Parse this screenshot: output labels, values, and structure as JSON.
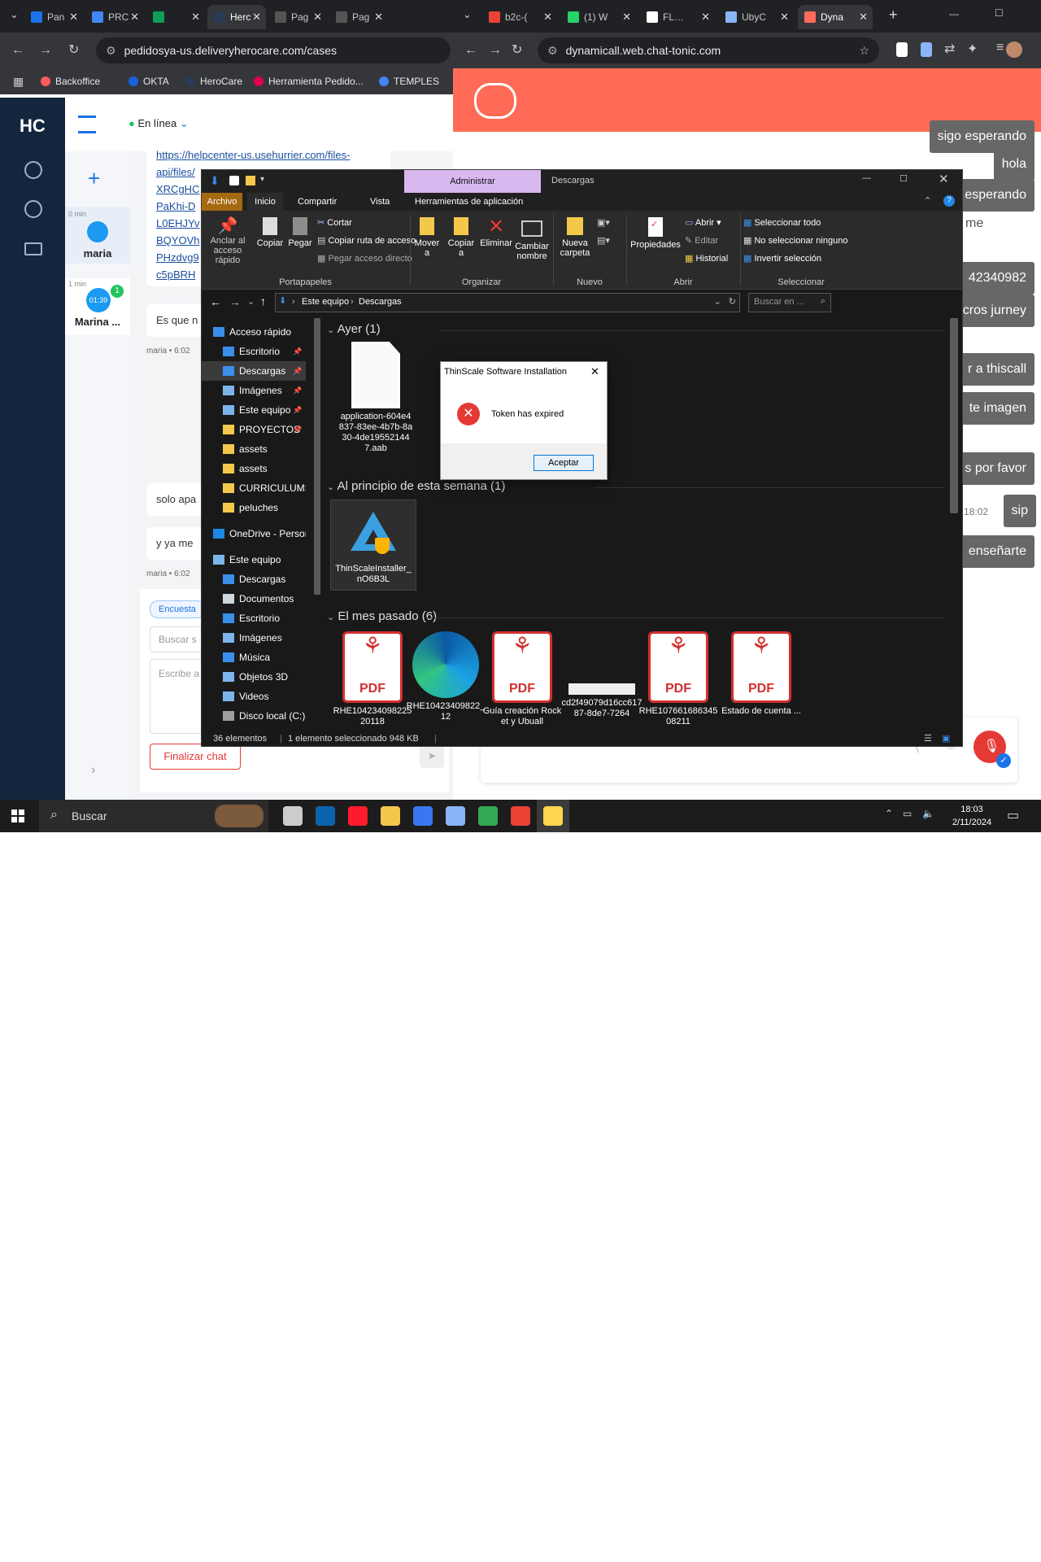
{
  "left_browser": {
    "tabs": [
      {
        "title": "Pan",
        "color": "#1a73e8"
      },
      {
        "title": "PRC",
        "color": "#4285f4"
      },
      {
        "title": "",
        "color": "#0f9d58"
      },
      {
        "title": "Herc",
        "color": "#2b3a55"
      },
      {
        "title": "Pag",
        "color": "#555555"
      },
      {
        "title": "Pag",
        "color": "#555555"
      }
    ],
    "url": "pedidosya-us.deliveryherocare.com/cases",
    "bookmarks": [
      {
        "label": "Backoffice",
        "color": "#ff5a5f"
      },
      {
        "label": "OKTA",
        "color": "#1662dd"
      },
      {
        "label": "HeroCare",
        "color": "#2b3a55"
      },
      {
        "label": "Herramienta Pedido...",
        "color": "#e0004d"
      },
      {
        "label": "TEMPLES",
        "color": "#4285f4"
      }
    ]
  },
  "herocare": {
    "logo": "HC",
    "status": "En línea",
    "contacts": [
      {
        "time": "0 min",
        "name": "maria",
        "timer": "",
        "badge": ""
      },
      {
        "time": "1 min",
        "name": "Marina ...",
        "timer": "01:39",
        "badge": "1"
      }
    ],
    "link_lines": [
      "https://helpcenter-us.usehurrier.com/files-",
      "api/files/",
      "XRCgHC",
      "PaKhi-D",
      "L0EHJYv",
      "BQYOVh",
      "PHzdvg9",
      "c5pBRH"
    ],
    "messages": [
      {
        "text": "Es que n",
        "meta": "maria • 6:02"
      },
      {
        "text": "solo apa",
        "meta": ""
      },
      {
        "text": "y ya me",
        "meta": "maria • 6:02"
      }
    ],
    "tag": "Encuesta",
    "search_placeholder": "Buscar s",
    "write_placeholder": "Escribe a",
    "end_chat": "Finalizar chat"
  },
  "right_browser": {
    "tabs": [
      {
        "title": "b2c-(",
        "color": "#ea4335"
      },
      {
        "title": "(1) W",
        "color": "#25d366"
      },
      {
        "title": "FLOR",
        "color": "#ffffff"
      },
      {
        "title": "UbyC",
        "color": "#8ab4f8"
      },
      {
        "title": "Dyna",
        "color": "#ff6b5a"
      }
    ],
    "url": "dynamicall.web.chat-tonic.com",
    "header_color": "#ff6b57",
    "messages": [
      {
        "text": "sigo esperando"
      },
      {
        "text": "hola"
      },
      {
        "text": "esperando"
      },
      {
        "text": "me"
      },
      {
        "text": "42340982"
      },
      {
        "text": "cros jurney"
      },
      {
        "text": "r a thiscall"
      },
      {
        "text": "te imagen"
      },
      {
        "text": "s por favor"
      },
      {
        "text": "sip",
        "time": "18:02"
      },
      {
        "text": "enseñarte"
      }
    ]
  },
  "explorer": {
    "title_tab_manage": "Administrar",
    "title": "Descargas",
    "ribbon_tabs": [
      "Archivo",
      "Inicio",
      "Compartir",
      "Vista",
      "Herramientas de aplicación"
    ],
    "clipboard": {
      "pin": "Anclar al acceso rápido",
      "copy": "Copiar",
      "paste": "Pegar",
      "cut": "Cortar",
      "copy_path": "Copiar ruta de acceso",
      "paste_shortcut": "Pegar acceso directo",
      "group": "Portapapeles"
    },
    "organize": {
      "move": "Mover a",
      "copy": "Copiar a",
      "delete": "Eliminar",
      "rename": "Cambiar nombre",
      "group": "Organizar"
    },
    "new": {
      "folder": "Nueva carpeta",
      "group": "Nuevo"
    },
    "open": {
      "properties": "Propiedades",
      "open": "Abrir",
      "edit": "Editar",
      "history": "Historial",
      "group": "Abrir"
    },
    "select": {
      "all": "Seleccionar todo",
      "none": "No seleccionar ninguno",
      "invert": "Invertir selección",
      "group": "Seleccionar"
    },
    "breadcrumb": [
      "Este equipo",
      "Descargas"
    ],
    "search_placeholder": "Buscar en ...",
    "nav": [
      {
        "label": "Acceso rápido",
        "indent": 0,
        "pin": false,
        "color": "#3b8eea"
      },
      {
        "label": "Escritorio",
        "indent": 1,
        "pin": true,
        "color": "#3b8eea"
      },
      {
        "label": "Descargas",
        "indent": 1,
        "pin": true,
        "color": "#3b8eea"
      },
      {
        "label": "Imágenes",
        "indent": 1,
        "pin": true,
        "color": "#7cb5ec"
      },
      {
        "label": "Este equipo",
        "indent": 1,
        "pin": true,
        "color": "#7cb5ec"
      },
      {
        "label": "PROYECTOS",
        "indent": 1,
        "pin": true,
        "color": "#f3c84b"
      },
      {
        "label": "assets",
        "indent": 1,
        "pin": false,
        "color": "#f3c84b"
      },
      {
        "label": "assets",
        "indent": 1,
        "pin": false,
        "color": "#f3c84b"
      },
      {
        "label": "CURRICULUMS",
        "indent": 1,
        "pin": false,
        "color": "#f3c84b"
      },
      {
        "label": "peluches",
        "indent": 1,
        "pin": false,
        "color": "#f3c84b"
      },
      {
        "label": "OneDrive - Person",
        "indent": 0,
        "pin": false,
        "color": "#1e88e5"
      },
      {
        "label": "Este equipo",
        "indent": 0,
        "pin": false,
        "color": "#7cb5ec"
      },
      {
        "label": "Descargas",
        "indent": 1,
        "pin": false,
        "color": "#3b8eea"
      },
      {
        "label": "Documentos",
        "indent": 1,
        "pin": false,
        "color": "#cfd8dc"
      },
      {
        "label": "Escritorio",
        "indent": 1,
        "pin": false,
        "color": "#3b8eea"
      },
      {
        "label": "Imágenes",
        "indent": 1,
        "pin": false,
        "color": "#7cb5ec"
      },
      {
        "label": "Música",
        "indent": 1,
        "pin": false,
        "color": "#3b8eea"
      },
      {
        "label": "Objetos 3D",
        "indent": 1,
        "pin": false,
        "color": "#7cb5ec"
      },
      {
        "label": "Videos",
        "indent": 1,
        "pin": false,
        "color": "#7cb5ec"
      },
      {
        "label": "Disco local (C:)",
        "indent": 1,
        "pin": false,
        "color": "#9e9e9e"
      }
    ],
    "sections": {
      "yesterday": "Ayer (1)",
      "this_week": "Al principio de esta semana (1)",
      "last_month": "El mes pasado (6)"
    },
    "files_yesterday": [
      {
        "name": "application-604e4837-83ee-4b7b-8a30-4de195521447.aab"
      }
    ],
    "files_week": [
      {
        "name": "ThinScaleInstaller_nO6B3L"
      }
    ],
    "files_month": [
      {
        "name": "RHE10423409822520118",
        "kind": "pdf"
      },
      {
        "name": "RHE10423409822_12",
        "kind": "edge"
      },
      {
        "name": "Guía creación Rocket y Ubuall",
        "kind": "pdf"
      },
      {
        "name": "cd2f49079d16cc61787-8de7-7264",
        "kind": "img"
      },
      {
        "name": "RHE10766168634508211",
        "kind": "pdf"
      },
      {
        "name": "Estado de cuenta ...",
        "kind": "pdf"
      }
    ],
    "status": {
      "count": "36 elementos",
      "selected": "1 elemento seleccionado 948 KB"
    }
  },
  "dialog": {
    "title": "ThinScale Software Installation",
    "message": "Token has expired",
    "ok": "Aceptar"
  },
  "taskbar": {
    "search": "Buscar",
    "time": "18:03",
    "date": "2/11/2024",
    "apps": [
      {
        "name": "task-view",
        "color": "#cccccc"
      },
      {
        "name": "outlook",
        "color": "#0a64ad"
      },
      {
        "name": "opera",
        "color": "#ff1b2d"
      },
      {
        "name": "file-explorer",
        "color": "#f3c84b"
      },
      {
        "name": "signal",
        "color": "#3a76f0"
      },
      {
        "name": "notepad",
        "color": "#8ab4f8"
      },
      {
        "name": "chrome",
        "color": "#34a853"
      },
      {
        "name": "chrome-2",
        "color": "#ea4335"
      },
      {
        "name": "thinscale",
        "color": "#ffd54f"
      }
    ]
  }
}
